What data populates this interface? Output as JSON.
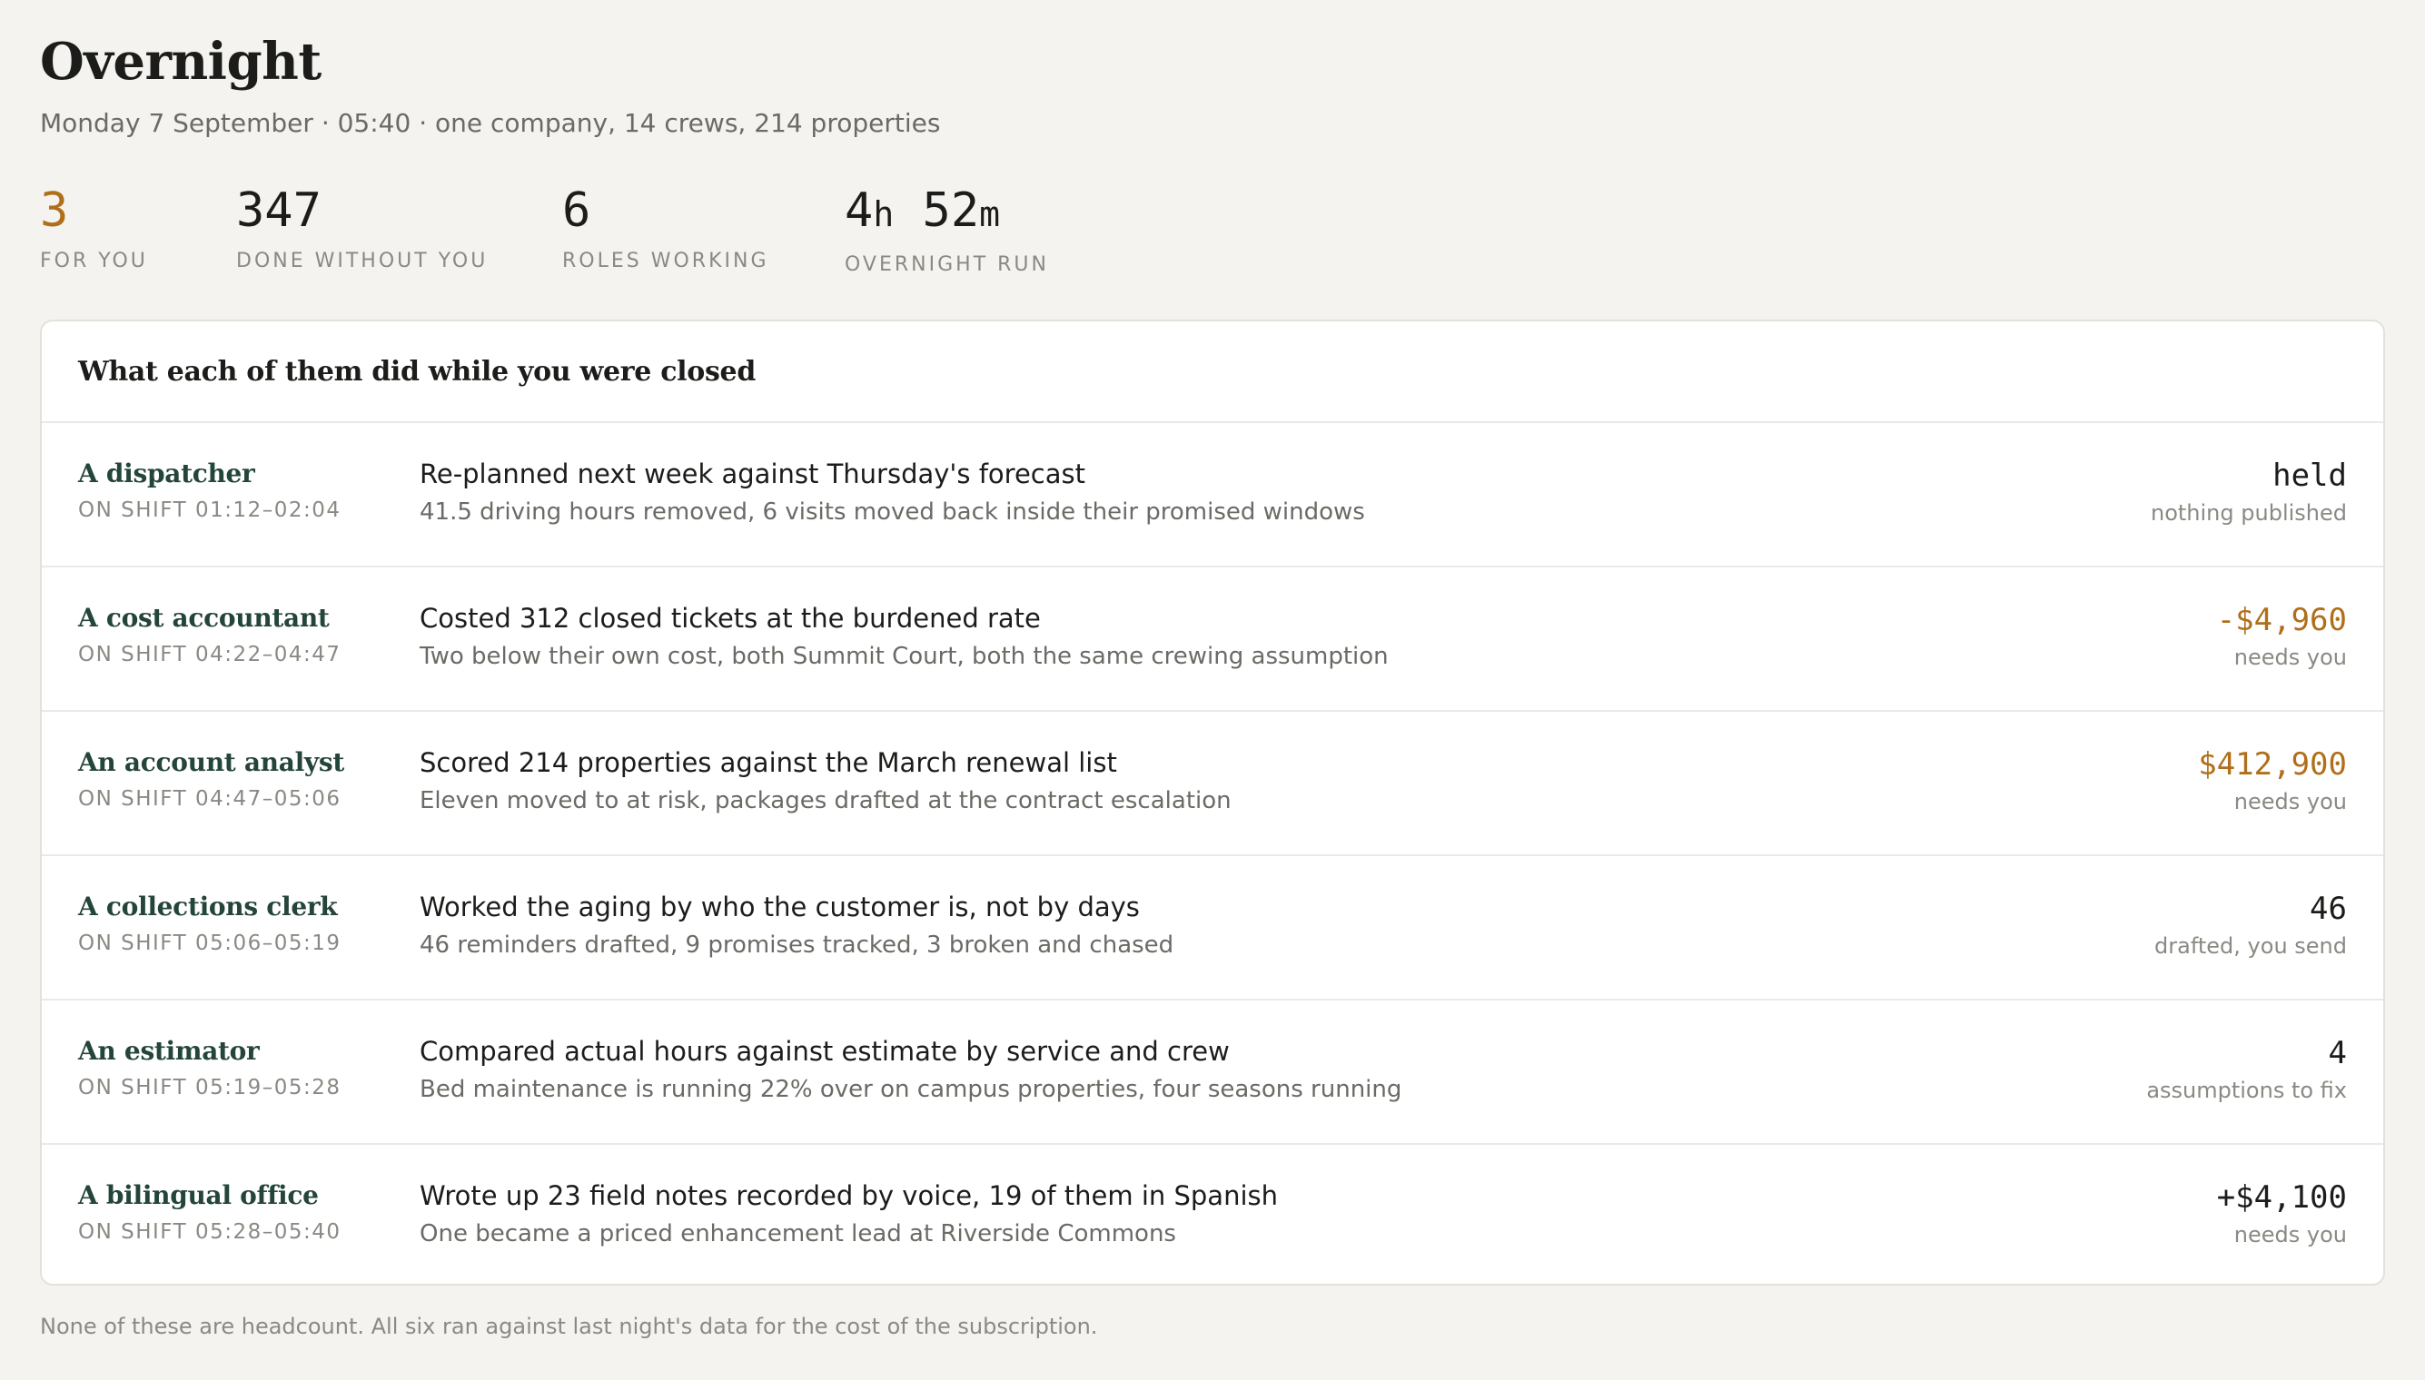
{
  "header": {
    "title": "Overnight",
    "subtitle": "Monday 7 September · 05:40 · one company, 14 crews, 214 properties"
  },
  "stats": [
    {
      "value": "3",
      "label": "FOR YOU"
    },
    {
      "value": "347",
      "label": "DONE WITHOUT YOU"
    },
    {
      "value": "6",
      "label": "ROLES WORKING"
    },
    {
      "value_hours": "4",
      "unit_hours": "h",
      "value_minutes": "52",
      "unit_minutes": "m",
      "label": "OVERNIGHT RUN"
    }
  ],
  "colors": {
    "accent": "#b06f1a",
    "role_name": "#24453a",
    "background": "#f4f3ef"
  },
  "card": {
    "title": "What each of them did while you were closed",
    "rows": [
      {
        "role": "A dispatcher",
        "shift": "ON SHIFT 01:12–02:04",
        "main": "Re-planned next week against Thursday's forecast",
        "sub": "41.5 driving hours removed, 6 visits moved back inside their promised windows",
        "metric": "held",
        "note": "nothing published",
        "accent": false
      },
      {
        "role": "A cost accountant",
        "shift": "ON SHIFT 04:22–04:47",
        "main": "Costed 312 closed tickets at the burdened rate",
        "sub": "Two below their own cost, both Summit Court, both the same crewing assumption",
        "metric": "-$4,960",
        "note": "needs you",
        "accent": true
      },
      {
        "role": "An account analyst",
        "shift": "ON SHIFT 04:47–05:06",
        "main": "Scored 214 properties against the March renewal list",
        "sub": "Eleven moved to at risk, packages drafted at the contract escalation",
        "metric": "$412,900",
        "note": "needs you",
        "accent": true
      },
      {
        "role": "A collections clerk",
        "shift": "ON SHIFT 05:06–05:19",
        "main": "Worked the aging by who the customer is, not by days",
        "sub": "46 reminders drafted, 9 promises tracked, 3 broken and chased",
        "metric": "46",
        "note": "drafted, you send",
        "accent": false
      },
      {
        "role": "An estimator",
        "shift": "ON SHIFT 05:19–05:28",
        "main": "Compared actual hours against estimate by service and crew",
        "sub": "Bed maintenance is running 22% over on campus properties, four seasons running",
        "metric": "4",
        "note": "assumptions to fix",
        "accent": false
      },
      {
        "role": "A bilingual office",
        "shift": "ON SHIFT 05:28–05:40",
        "main": "Wrote up 23 field notes recorded by voice, 19 of them in Spanish",
        "sub": "One became a priced enhancement lead at Riverside Commons",
        "metric": "+$4,100",
        "note": "needs you",
        "accent": false
      }
    ]
  },
  "footnote": "None of these are headcount. All six ran against last night's data for the cost of the subscription."
}
